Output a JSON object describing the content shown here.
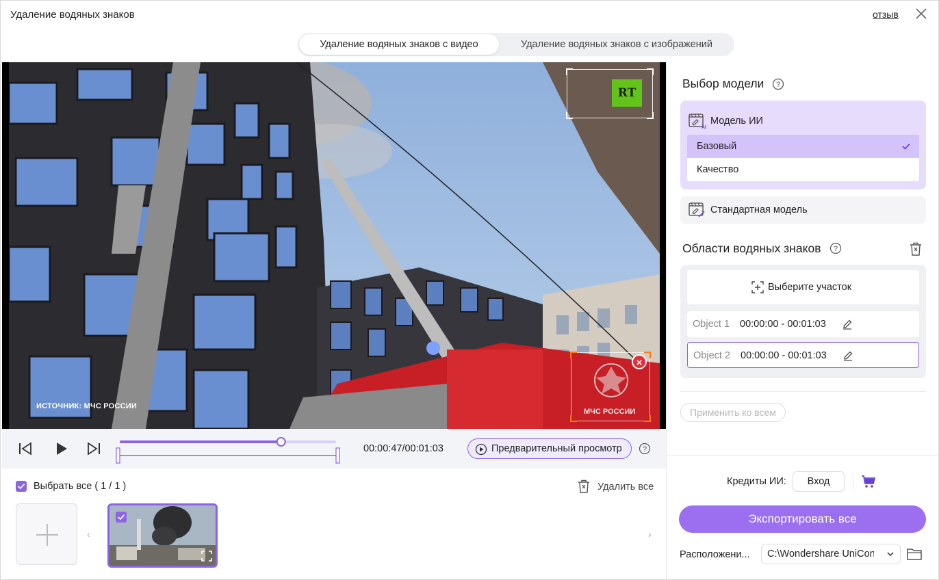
{
  "window": {
    "title": "Удаление водяных знаков",
    "feedback_link": "отзыв"
  },
  "mode_tabs": [
    {
      "label": "Удаление водяных знаков с видео",
      "active": true
    },
    {
      "label": "Удаление водяных знаков с изображений",
      "active": false
    }
  ],
  "video": {
    "overlay_source": "ИСТОЧНИК: МЧС РОССИИ",
    "watermark_logo": "RT",
    "watermark_emblem_text": "МЧС РОССИИ"
  },
  "player": {
    "time": "00:00:47/00:01:03",
    "progress_fraction": 0.746,
    "preview_label": "Предварительный просмотр"
  },
  "file_list": {
    "select_all": "Выбрать все ( 1 / 1 )",
    "delete_all": "Удалить все"
  },
  "panel": {
    "model_title": "Выбор модели",
    "ai_model": {
      "label": "Модель ИИ",
      "options": [
        {
          "label": "Базовый",
          "selected": true
        },
        {
          "label": "Качество",
          "selected": false
        }
      ]
    },
    "standard_model": "Стандартная модель",
    "areas_title": "Области водяных знаков",
    "choose_area": "Выберите участок",
    "objects": [
      {
        "name": "Object 1",
        "range": "00:00:00 - 00:01:03",
        "selected": false
      },
      {
        "name": "Object 2",
        "range": "00:00:00 - 00:01:03",
        "selected": true
      }
    ],
    "apply_all": "Применить ко всем",
    "credits_label": "Кредиты ИИ:",
    "login": "Вход",
    "export_all": "Экспортировать все",
    "location_label": "Расположени...",
    "location_value": "C:\\Wondershare UniConv"
  },
  "colors": {
    "accent": "#8b63e6",
    "export": "#9b6ff0",
    "model_bg": "#e8dcfd",
    "delete_red": "#e0313b",
    "rt_green": "#62c41a"
  }
}
